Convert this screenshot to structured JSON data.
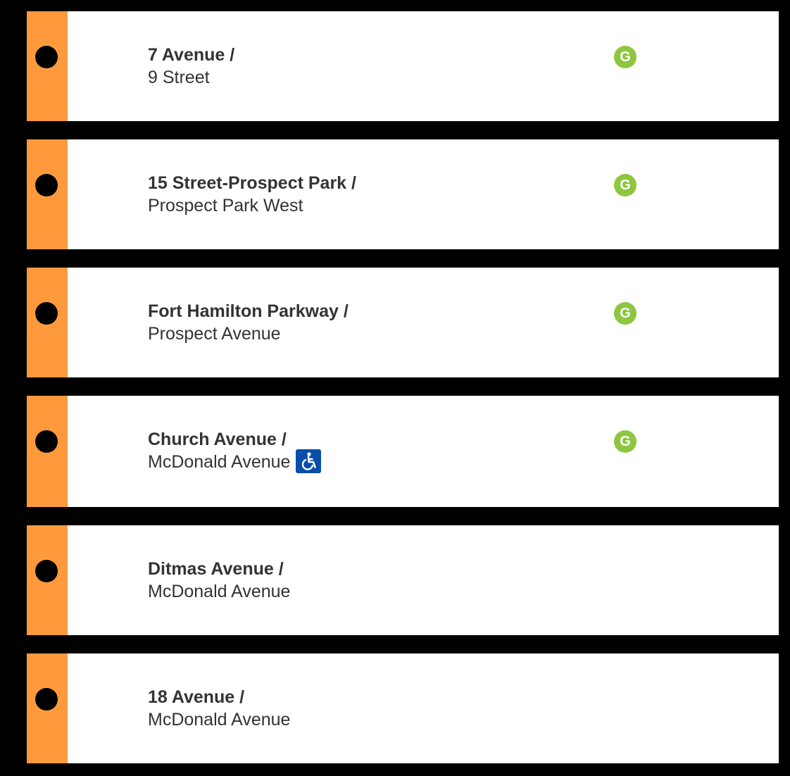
{
  "colors": {
    "line": "#ff9a3c",
    "transfer_g": "#8dc63f",
    "ada": "#0a4ea8"
  },
  "stations": [
    {
      "primary": "7 Avenue /",
      "secondary": "9 Street",
      "accessible": false,
      "transfers": [
        "G"
      ]
    },
    {
      "primary": "15 Street-Prospect Park /",
      "secondary": "Prospect Park West",
      "accessible": false,
      "transfers": [
        "G"
      ]
    },
    {
      "primary": "Fort Hamilton Parkway /",
      "secondary": "Prospect Avenue",
      "accessible": false,
      "transfers": [
        "G"
      ]
    },
    {
      "primary": "Church Avenue /",
      "secondary": "McDonald Avenue",
      "accessible": true,
      "accessible_icon": "wheelchair-icon",
      "transfers": [
        "G"
      ]
    },
    {
      "primary": "Ditmas Avenue /",
      "secondary": "McDonald Avenue",
      "accessible": false,
      "transfers": []
    },
    {
      "primary": "18 Avenue /",
      "secondary": "McDonald Avenue",
      "accessible": false,
      "transfers": []
    }
  ]
}
